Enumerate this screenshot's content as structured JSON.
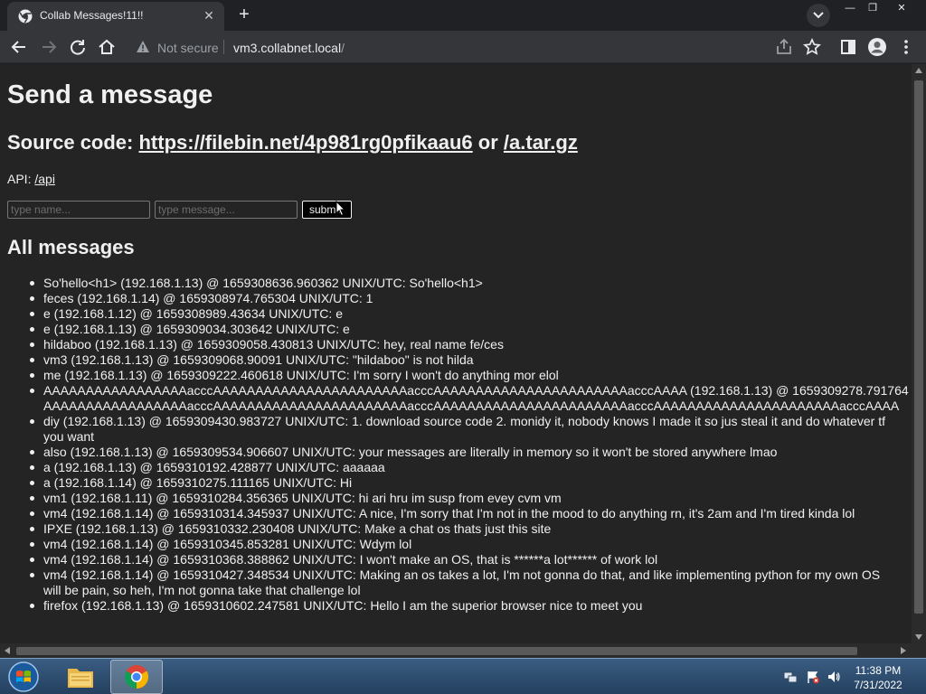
{
  "browser": {
    "tab_title": "Collab Messages!11!!",
    "new_tab_symbol": "+",
    "close_symbol": "✕",
    "security_label": "Not secure",
    "url_host": "vm3.collabnet.local",
    "url_path": "/",
    "window_controls": {
      "minimize": "—",
      "restore": "❐",
      "close": "✕"
    }
  },
  "page": {
    "title": "Send a message",
    "source_prefix": "Source code: ",
    "source_link": "https://filebin.net/4p981rg0pfikaau6",
    "source_or": " or ",
    "archive_link": "/a.tar.gz",
    "api_prefix": "API: ",
    "api_link": "/api",
    "name_placeholder": "type name...",
    "message_placeholder": "type message...",
    "submit_label": "submit",
    "messages_heading": "All messages",
    "messages": [
      "So'hello<h1> (192.168.1.13) @ 1659308636.960362 UNIX/UTC: So'hello<h1>",
      "feces (192.168.1.14) @ 1659308974.765304 UNIX/UTC: 1",
      "e (192.168.1.12) @ 1659308989.43634 UNIX/UTC: e",
      "e (192.168.1.13) @ 1659309034.303642 UNIX/UTC: e",
      "hildaboo (192.168.1.13) @ 1659309058.430813 UNIX/UTC: hey, real name fe/ces",
      "vm3 (192.168.1.13) @ 1659309068.90091 UNIX/UTC: \"hildaboo\" is not hilda",
      "me (192.168.1.13) @ 1659309222.460618 UNIX/UTC: I'm sorry I won't do anything mor elol",
      "AAAAAAAAAAAAAAAAAacccAAAAAAAAAAAAAAAAAAAAAAAacccAAAAAAAAAAAAAAAAAAAAAAAacccAAAA (192.168.1.13) @ 1659309278.791764 UNIX/UTC: AAAAAAAAAAAAAAAAAacccAAAAAAAAAAAAAAAAAAAAAAAacccAAAAAAAAAAAAAAAAAAAAAAAacccAAAAAAAAAAAAAAAAAAAAAAacccAAAA",
      "diy (192.168.1.13) @ 1659309430.983727 UNIX/UTC: 1. download source code 2. monidy it, nobody knows I made it so jus steal it and do whatever tf you want",
      "also (192.168.1.13) @ 1659309534.906607 UNIX/UTC: your messages are literally in memory so it won't be stored anywhere lmao",
      "a (192.168.1.13) @ 1659310192.428877 UNIX/UTC: aaaaaa",
      "a (192.168.1.14) @ 1659310275.111165 UNIX/UTC: Hi",
      "vm1 (192.168.1.11) @ 1659310284.356365 UNIX/UTC: hi ari hru im susp from evey cvm vm",
      "vm4 (192.168.1.14) @ 1659310314.345937 UNIX/UTC: A nice, I'm sorry that I'm not in the mood to do anything rn, it's 2am and I'm tired kinda lol",
      "IPXE (192.168.1.13) @ 1659310332.230408 UNIX/UTC: Make a chat os thats just this site",
      "vm4 (192.168.1.14) @ 1659310345.853281 UNIX/UTC: Wdym lol",
      "vm4 (192.168.1.14) @ 1659310368.388862 UNIX/UTC: I won't make an OS, that is ******a lot****** of work lol",
      "vm4 (192.168.1.14) @ 1659310427.348534 UNIX/UTC: Making an os takes a lot, I'm not gonna do that, and like implementing python for my own OS will be pain, so heh, I'm not gonna take that challenge lol",
      "firefox (192.168.1.13) @ 1659310602.247581 UNIX/UTC: Hello I am the superior browser nice to meet you"
    ]
  },
  "taskbar": {
    "time": "11:38 PM",
    "date": "7/31/2022"
  },
  "icons": [
    "chrome-favicon",
    "back-icon",
    "forward-icon",
    "reload-icon",
    "home-icon",
    "warning-icon",
    "share-icon",
    "star-icon",
    "sidepanel-icon",
    "profile-icon",
    "menu-icon",
    "windows-start-icon",
    "explorer-icon",
    "chrome-icon",
    "tray-network-icon",
    "tray-flag-icon",
    "tray-volume-icon"
  ],
  "colors": {
    "page_bg": "#242424",
    "text": "#f0f0f0",
    "chrome_dark": "#202124",
    "chrome_toolbar": "#35363a"
  }
}
